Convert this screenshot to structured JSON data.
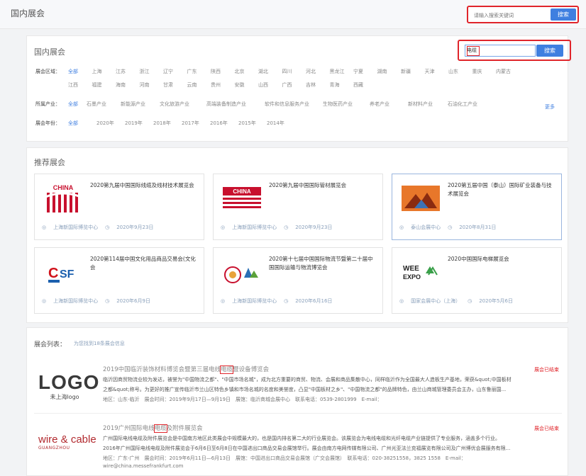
{
  "header": {
    "title": "国内展会",
    "search_placeholder": "请输入搜索关键词",
    "search_button": "搜索"
  },
  "filter": {
    "title": "国内展会",
    "search_value": "电缆",
    "search_button": "搜索",
    "region_label": "展会区域：",
    "region_row1": [
      "全部",
      "上海",
      "江苏",
      "浙江",
      "辽宁",
      "广东",
      "陕西",
      "北京",
      "湖北",
      "四川",
      "河北",
      "黑龙江",
      "宁夏",
      "湖南",
      "新疆",
      "天津",
      "山东",
      "重庆",
      "内蒙古"
    ],
    "region_row2": [
      "江西",
      "福建",
      "海南",
      "河南",
      "甘肃",
      "云南",
      "贵州",
      "安徽",
      "山西",
      "广西",
      "吉林",
      "青海",
      "西藏"
    ],
    "industry_label": "所属产业：",
    "industries": [
      "全部",
      "石墨产业",
      "新能源产业",
      "文化旅游产业",
      "高端装备制造产业",
      "软件和信息服务产业",
      "生物医药产业",
      "养老产业",
      "新材料产业",
      "石油化工产业"
    ],
    "more": "更多",
    "year_label": "展会年份：",
    "years": [
      "全部",
      "2020年",
      "2019年",
      "2018年",
      "2017年",
      "2016年",
      "2015年",
      "2014年"
    ]
  },
  "recommend": {
    "title": "推荐展会",
    "cards": [
      {
        "title": "2020第九届中国国际线缆及线材技术展览会",
        "venue": "上海新国际博览中心",
        "date": "2020年9月23日",
        "logo": "CHINA"
      },
      {
        "title": "2020第九届中国国际管材展览会",
        "venue": "上海新国际博览中心",
        "date": "2020年9月23日",
        "logo": "CHINA"
      },
      {
        "title": "2020第五届中国（泰山）国际矿业装备与技术展览会",
        "venue": "泰山会展中心",
        "date": "2020年8月31日",
        "logo": "mountain"
      },
      {
        "title": "2020第114届中国文化用品商品交易会(文化会",
        "venue": "上海新国际博览中心",
        "date": "2020年6月9日",
        "logo": "CSF"
      },
      {
        "title": "2020第十七届中国国际物流节暨第二十届中国国际运输与物流博览会",
        "venue": "上海新国际博览中心",
        "date": "2020年6月16日",
        "logo": "logistics"
      },
      {
        "title": "2020中国国际电梯展览会",
        "venue": "国家会展中心（上海）",
        "date": "2020年5月6日",
        "logo": "WEE EXPO"
      }
    ]
  },
  "list": {
    "title": "展会列表：",
    "count_text": "为您找到18条展会信息",
    "items": [
      {
        "logo_text": "LOGO",
        "logo_sub": "未上海logo",
        "title_pre": "2019中国临沂装饰材料博览会暨第三届电线",
        "title_hl": "电缆",
        "title_post": "暨设备博览会",
        "status": "展会已结束",
        "desc1": "临沂因商贸物流业较为发达，被誉为\"中国物流之都\"、\"中国市场名城\"，成为北方重要的商贸、物流、会展和商品集散中心，同样临沂作为全国最大人造板生产基地，荣获&quot;中国板材",
        "desc2": "之都&quot;称号。为更好的推广宣传临沂市兰山区特色乡镇和市场名城的名度和美誉度，凸显\"中国板材之乡\"、\"中国物流之都\"的品牌特色，由兰山商城管理委员会主办，山东鲁丽国...",
        "meta": "地区：山东-临沂　展会时间：2019年9月17日—9月19日　展馆：临沂商城会展中心　联系电话：0539-2801999　E-mail："
      },
      {
        "logo_text": "wire & cable",
        "logo_sub": "GUANGZHOU",
        "title_pre": "2019广州国际电线",
        "title_hl": "电缆",
        "title_post": "及附件展览会",
        "status": "展会已结束",
        "desc1": "广州国际电线电缆及附件展览会是中国南方地区此类展会中规模最大的，也是国内排名第二大的行业展览会。该展览会为电线电缆和光纤电缆产业链提供了专业服务，涵盖多个行业。",
        "desc2": "2016年广州国际电线电缆及附件展览会于6月6日至6月8日在中国进出口商品交易会展馆举行。展会由南方电网传媒有限公司、广州光亚法兰克福展览有限公司及广州博优会展服务有限...",
        "meta": "地区：广东-广州　展会时间：2019年6月11日—6月13日　展馆：中国进出口商品交易会展馆（广交会展馆）　联系电话：020-38251558，3825 1558　E-mail：",
        "email": "wire@china.messefrankfurt.com"
      }
    ]
  }
}
